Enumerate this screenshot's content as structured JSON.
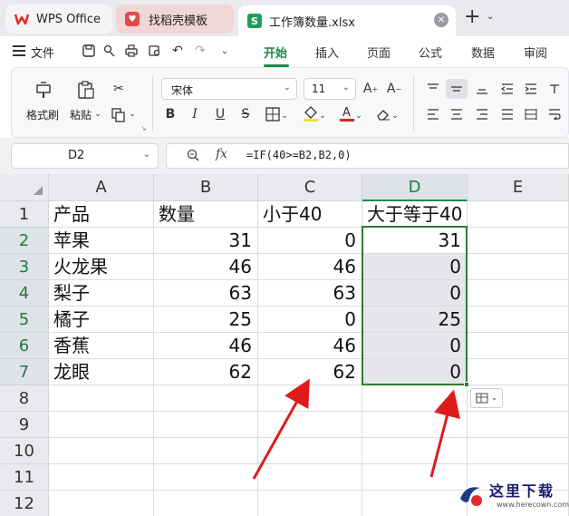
{
  "tabs": {
    "wps": "WPS Office",
    "template": "找稻壳模板",
    "file": "工作簿数量.xlsx"
  },
  "menu": {
    "file": "文件",
    "tabs": [
      "开始",
      "插入",
      "页面",
      "公式",
      "数据",
      "审阅"
    ],
    "active_tab": "开始"
  },
  "ribbon": {
    "format_painter": "格式刷",
    "paste": "粘贴",
    "font_name": "宋体",
    "font_size": "11",
    "bold": "B",
    "italic": "I",
    "underline": "U",
    "strikethrough": "S"
  },
  "formula_bar": {
    "cell_ref": "D2",
    "formula": "=IF(40>=B2,B2,0)"
  },
  "sheet": {
    "columns": [
      "A",
      "B",
      "C",
      "D",
      "E"
    ],
    "selected_column": "D",
    "row_numbers": [
      "1",
      "2",
      "3",
      "4",
      "5",
      "6",
      "7",
      "8",
      "9",
      "10",
      "11",
      "12"
    ],
    "header_row": [
      "产品",
      "数量",
      "小于40",
      "大于等于40"
    ],
    "rows": [
      [
        "苹果",
        "31",
        "0",
        "31"
      ],
      [
        "火龙果",
        "46",
        "46",
        "0"
      ],
      [
        "梨子",
        "63",
        "63",
        "0"
      ],
      [
        "橘子",
        "25",
        "0",
        "25"
      ],
      [
        "香蕉",
        "46",
        "46",
        "0"
      ],
      [
        "龙眼",
        "62",
        "62",
        "0"
      ]
    ]
  },
  "watermark": {
    "title": "这里下载",
    "url": "www.herecown.com"
  },
  "colors": {
    "accent": "#1d8a4e",
    "selection_border": "#2e7d32",
    "arrow": "#e01b1b"
  }
}
